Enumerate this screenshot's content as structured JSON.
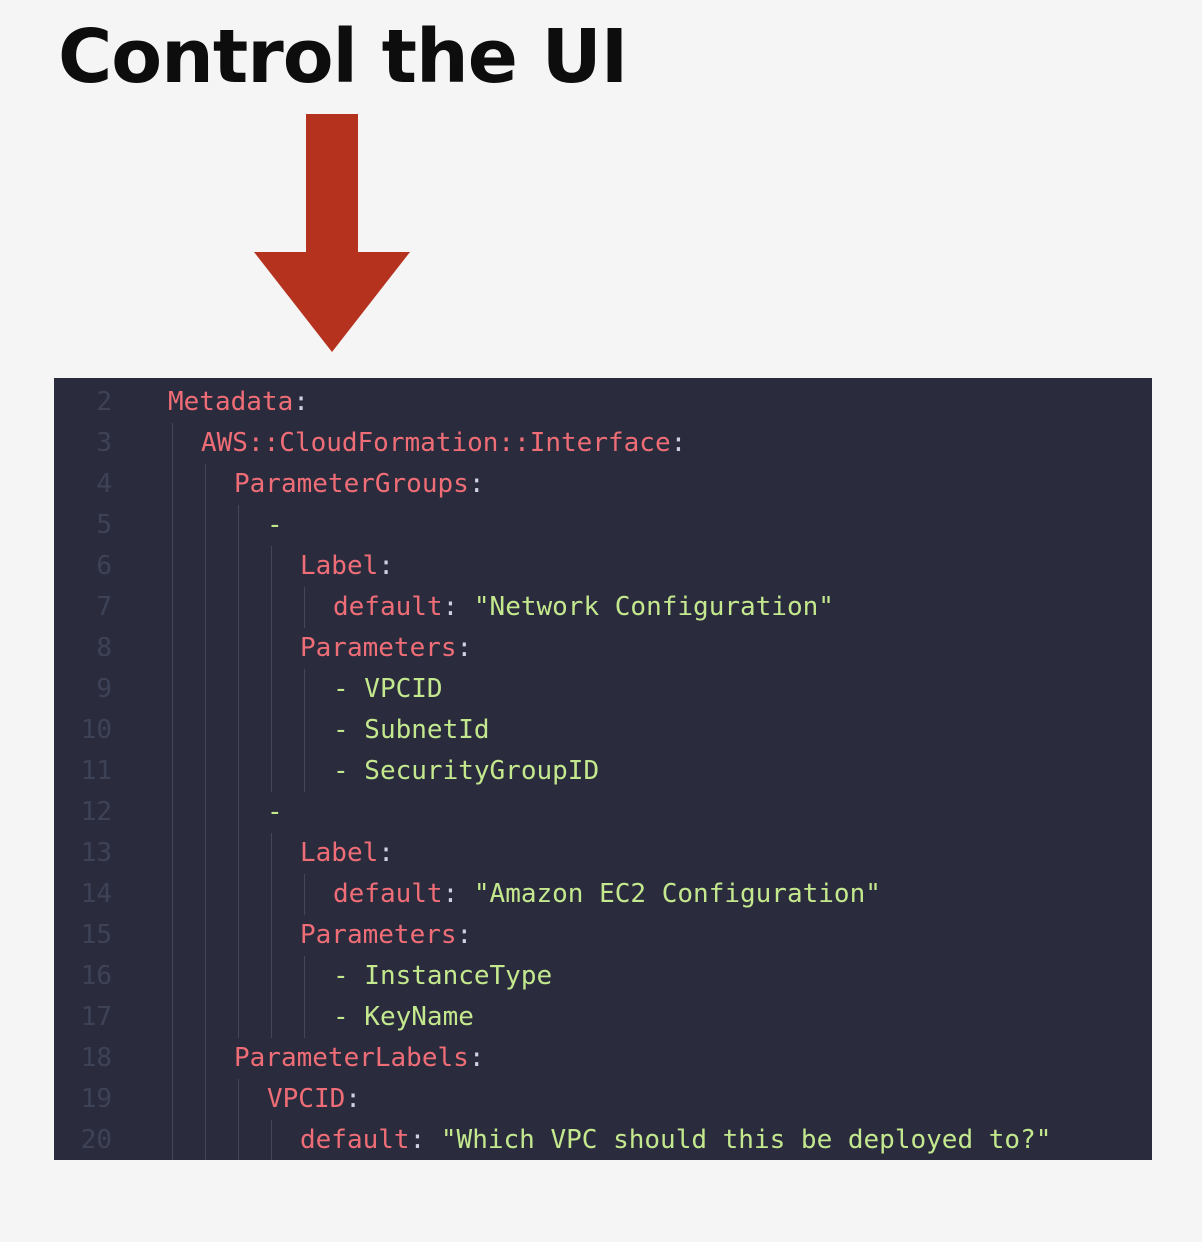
{
  "slide": {
    "title": "Control the UI",
    "arrow_color": "#b5321f",
    "arrow_icon": "arrow-down-icon"
  },
  "editor": {
    "background": "#2a2c3d",
    "lines": [
      {
        "num": "2",
        "key": "Metadata",
        "sep": ":",
        "value": ""
      },
      {
        "num": "3",
        "key": "AWS::CloudFormation::Interface",
        "sep": ":",
        "value": ""
      },
      {
        "num": "4",
        "key": "ParameterGroups",
        "sep": ":",
        "value": ""
      },
      {
        "num": "5",
        "key": "",
        "sep": "",
        "value": "-"
      },
      {
        "num": "6",
        "key": "Label",
        "sep": ":",
        "value": ""
      },
      {
        "num": "7",
        "key": "default",
        "sep": ": ",
        "value": "\"Network Configuration\""
      },
      {
        "num": "8",
        "key": "Parameters",
        "sep": ":",
        "value": ""
      },
      {
        "num": "9",
        "key": "",
        "sep": "",
        "value": "- VPCID"
      },
      {
        "num": "10",
        "key": "",
        "sep": "",
        "value": "- SubnetId"
      },
      {
        "num": "11",
        "key": "",
        "sep": "",
        "value": "- SecurityGroupID"
      },
      {
        "num": "12",
        "key": "",
        "sep": "",
        "value": "-"
      },
      {
        "num": "13",
        "key": "Label",
        "sep": ":",
        "value": ""
      },
      {
        "num": "14",
        "key": "default",
        "sep": ": ",
        "value": "\"Amazon EC2 Configuration\""
      },
      {
        "num": "15",
        "key": "Parameters",
        "sep": ":",
        "value": ""
      },
      {
        "num": "16",
        "key": "",
        "sep": "",
        "value": "- InstanceType"
      },
      {
        "num": "17",
        "key": "",
        "sep": "",
        "value": "- KeyName"
      },
      {
        "num": "18",
        "key": "ParameterLabels",
        "sep": ":",
        "value": ""
      },
      {
        "num": "19",
        "key": "VPCID",
        "sep": ":",
        "value": ""
      },
      {
        "num": "20",
        "key": "default",
        "sep": ": ",
        "value": "\"Which VPC should this be deployed to?\""
      }
    ]
  }
}
